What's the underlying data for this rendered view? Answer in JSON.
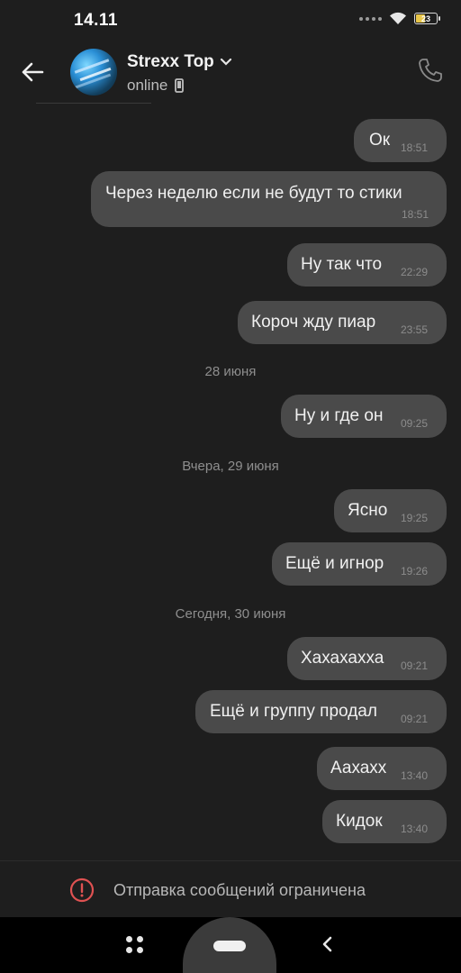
{
  "status_bar": {
    "time": "14.11",
    "battery": "23"
  },
  "header": {
    "contact_name": "Strexx Top",
    "status": "online"
  },
  "messages": [
    {
      "text": "Ок",
      "time": "18:51"
    },
    {
      "text": "Через неделю если не будут то стики",
      "time": "18:51"
    },
    {
      "text": "Ну так что",
      "time": "22:29"
    },
    {
      "text": "Короч жду пиар",
      "time": "23:55"
    },
    {
      "text": "Ну и где он",
      "time": "09:25"
    },
    {
      "text": "Ясно",
      "time": "19:25"
    },
    {
      "text": "Ещё и игнор",
      "time": "19:26"
    },
    {
      "text": "Хахахахха",
      "time": "09:21"
    },
    {
      "text": "Ещё и группу продал",
      "time": "09:21"
    },
    {
      "text": "Аахахх",
      "time": "13:40"
    },
    {
      "text": "Кидок",
      "time": "13:40"
    }
  ],
  "date_separators": [
    "28 июня",
    "Вчера, 29 июня",
    "Сегодня, 30 июня"
  ],
  "restriction": {
    "text": "Отправка сообщений ограничена",
    "icon": "alert-circle-icon",
    "color": "#e05252"
  },
  "colors": {
    "background": "#1e1e1e",
    "bubble": "#4a4a4a",
    "navbar": "#000000"
  }
}
